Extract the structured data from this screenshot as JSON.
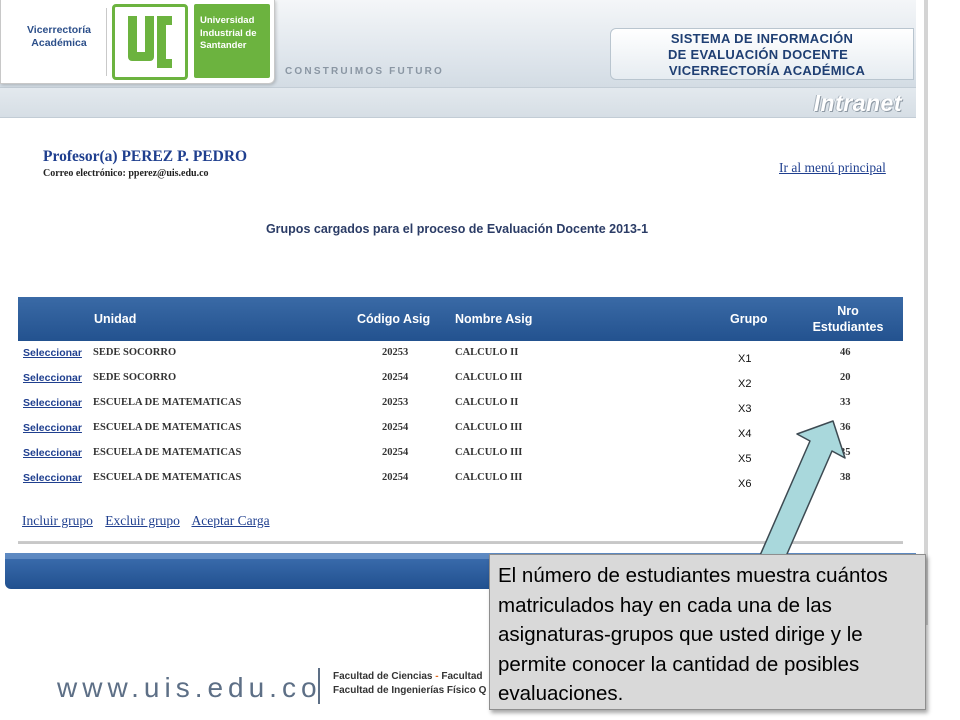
{
  "header": {
    "vice_line1": "Vicerrectoría",
    "vice_line2": "Académica",
    "university": [
      "Universidad",
      "Industrial de",
      "Santander"
    ],
    "slogan": "CONSTRUIMOS FUTURO",
    "system_title": [
      "SISTEMA DE INFORMACIÓN",
      "DE EVALUACIÓN DOCENTE",
      "VICERRECTORÍA ACADÉMICA"
    ],
    "intranet": "Intranet"
  },
  "professor": {
    "name": "Profesor(a) PEREZ P. PEDRO",
    "email_label": "Correo electrónico:",
    "email": "pperez@uis.edu.co"
  },
  "nav": {
    "main_menu": "Ir al menú principal"
  },
  "page": {
    "heading": "Grupos cargados para el proceso de Evaluación Docente 2013-1"
  },
  "table": {
    "headers": {
      "unidad": "Unidad",
      "codigo": "Código Asig",
      "nombre": "Nombre Asig",
      "grupo": "Grupo",
      "nro_line1": "Nro",
      "nro_line2": "Estudiantes"
    },
    "select_label": "Seleccionar",
    "rows": [
      {
        "unidad": "SEDE SOCORRO",
        "codigo": "20253",
        "nombre": "CALCULO II",
        "grupo": "X1",
        "nro": "46"
      },
      {
        "unidad": "SEDE SOCORRO",
        "codigo": "20254",
        "nombre": "CALCULO III",
        "grupo": "X2",
        "nro": "20"
      },
      {
        "unidad": "ESCUELA DE MATEMATICAS",
        "codigo": "20253",
        "nombre": "CALCULO II",
        "grupo": "X3",
        "nro": "33"
      },
      {
        "unidad": "ESCUELA DE MATEMATICAS",
        "codigo": "20254",
        "nombre": "CALCULO III",
        "grupo": "X4",
        "nro": "36"
      },
      {
        "unidad": "ESCUELA DE MATEMATICAS",
        "codigo": "20254",
        "nombre": "CALCULO III",
        "grupo": "X5",
        "nro": "35"
      },
      {
        "unidad": "ESCUELA DE MATEMATICAS",
        "codigo": "20254",
        "nombre": "CALCULO III",
        "grupo": "X6",
        "nro": "38"
      }
    ]
  },
  "actions": {
    "include": "Incluir grupo",
    "exclude": "Excluir grupo",
    "accept": "Aceptar Carga"
  },
  "footer": {
    "url": "www.uis.edu.co",
    "faculty_line1_a": "Facultad de Ciencias",
    "faculty_line1_sep": " - ",
    "faculty_line1_b": "Facultad",
    "faculty_line2": "Facultad de Ingenierías Físico Q"
  },
  "callout": {
    "text": "El número de estudiantes muestra cuántos matriculados hay en cada una de las asignaturas-grupos que usted dirige y le permite conocer la cantidad de posibles evaluaciones."
  },
  "colors": {
    "brand_green": "#6cb33f",
    "brand_blue": "#2c4f8a",
    "table_header": "#2a5a98",
    "arrow_fill": "#a9d8dc"
  }
}
